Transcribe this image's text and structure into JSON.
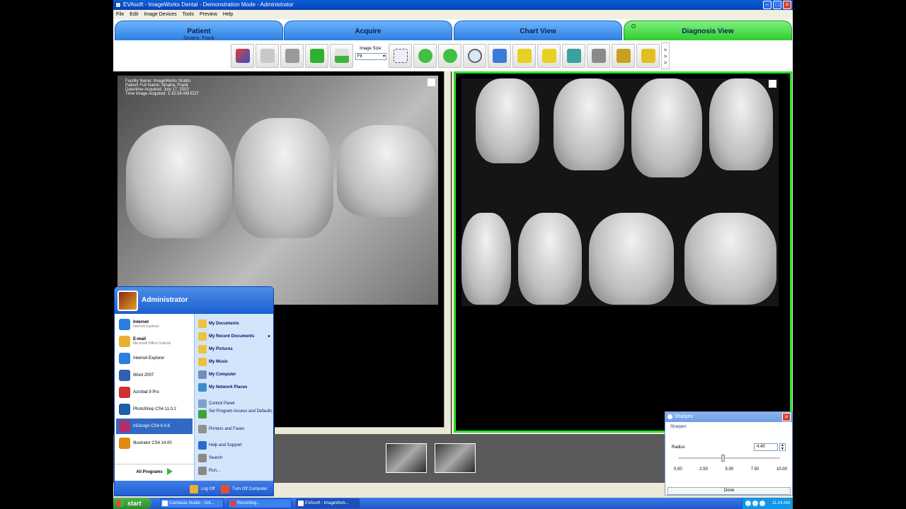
{
  "window": {
    "title": "EVAsoft - ImageWorks Dental - Demonstration Mode - Administrator",
    "menu": [
      "File",
      "Edit",
      "Image Devices",
      "Tools",
      "Preview",
      "Help"
    ]
  },
  "tabs": [
    {
      "label": "Patient",
      "sub": "Sinatra, Frank"
    },
    {
      "label": "Acquire",
      "sub": ""
    },
    {
      "label": "Chart View",
      "sub": ""
    },
    {
      "label": "Diagnosis View",
      "sub": "",
      "active": true
    }
  ],
  "toolbar": {
    "image_size_label": "Image Size:",
    "image_size_value": "Fit",
    "more": [
      ">",
      ">",
      ">"
    ]
  },
  "viewer": {
    "info_lines": [
      "Facility Name: ImageWorks Studio",
      "Patient Full Name: Sinatra, Frank",
      "Date/time Acquired: July 17, 2010",
      "Time Image Acquired: 1:15:34 AM EDT"
    ]
  },
  "sharpen": {
    "title": "Sharpen",
    "subtitle": "Sharpen",
    "radius_label": "Radius",
    "radius_value": "4.40",
    "slider_fraction": 0.44,
    "ticks": [
      "0.00",
      "2.50",
      "5.00",
      "7.50",
      "10.00"
    ],
    "done_label": "Done"
  },
  "start_menu": {
    "user": "Administrator",
    "left_items": [
      {
        "label": "Internet",
        "sub": "Internet Explorer",
        "bold": true,
        "icon": "ie-icon",
        "color": "#2a7de1"
      },
      {
        "label": "E-mail",
        "sub": "Microsoft Office Outlook",
        "bold": true,
        "icon": "outlook-icon",
        "color": "#e8b030"
      },
      {
        "label": "Internet Explorer",
        "sub": "",
        "bold": false,
        "icon": "ie-icon",
        "color": "#2a7de1"
      },
      {
        "label": "Word 2007",
        "sub": "",
        "bold": false,
        "icon": "word-icon",
        "color": "#2f5fb3"
      },
      {
        "label": "Acrobat 9 Pro",
        "sub": "",
        "bold": false,
        "icon": "acrobat-icon",
        "color": "#d03030"
      },
      {
        "label": "PhotoShop CS4 11.0.2",
        "sub": "",
        "bold": false,
        "icon": "photoshop-icon",
        "color": "#1d5ea8"
      },
      {
        "label": "InDesign CS4 6.0.6",
        "sub": "",
        "bold": false,
        "icon": "indesign-icon",
        "color": "#b0306a",
        "highlight": true
      },
      {
        "label": "Illustrator CS4 14.00",
        "sub": "",
        "bold": false,
        "icon": "illustrator-icon",
        "color": "#e08a10"
      }
    ],
    "all_programs": "All Programs",
    "right_items": [
      {
        "label": "My Documents",
        "bold": true,
        "icon": "folder-icon",
        "color": "#f0c040"
      },
      {
        "label": "My Recent Documents",
        "bold": true,
        "icon": "recent-docs-icon",
        "color": "#f0c040",
        "arrow": "▸"
      },
      {
        "label": "My Pictures",
        "bold": true,
        "icon": "pictures-icon",
        "color": "#f0c040"
      },
      {
        "label": "My Music",
        "bold": true,
        "icon": "music-icon",
        "color": "#f0c040"
      },
      {
        "label": "My Computer",
        "bold": true,
        "icon": "computer-icon",
        "color": "#6f8fbf"
      },
      {
        "label": "My Network Places",
        "bold": true,
        "icon": "network-icon",
        "color": "#3a8ad0"
      },
      {
        "label": "Control Panel",
        "bold": false,
        "icon": "control-panel-icon",
        "color": "#7fa0c8"
      },
      {
        "label": "Set Program Access and Defaults",
        "bold": false,
        "icon": "program-access-icon",
        "color": "#40a040"
      },
      {
        "label": "Printers and Faxes",
        "bold": false,
        "icon": "printer-icon",
        "color": "#909090"
      },
      {
        "label": "Help and Support",
        "bold": false,
        "icon": "help-icon",
        "color": "#2a6ad0"
      },
      {
        "label": "Search",
        "bold": false,
        "icon": "search-icon",
        "color": "#8a8a8a"
      },
      {
        "label": "Run...",
        "bold": false,
        "icon": "run-icon",
        "color": "#8a8a8a"
      }
    ],
    "log_off": "Log Off",
    "turn_off": "Turn Off Computer"
  },
  "taskbar": {
    "start": "start",
    "tasks": [
      {
        "label": "Camtasia Studio - Unt...",
        "active": false
      },
      {
        "label": "Recording...",
        "active": false
      },
      {
        "label": "EVAsoft - ImageWork...",
        "active": true
      }
    ],
    "clock": "11:24 AM"
  }
}
